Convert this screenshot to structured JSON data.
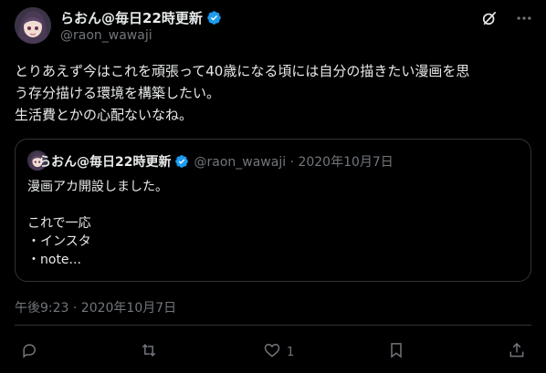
{
  "author": {
    "display_name": "らおん@毎日22時更新",
    "handle": "@raon_wawaji"
  },
  "tweet": {
    "text": "とりあえず今はこれを頑張って40歳になる頃には自分の描きたい漫画を思\nう存分描ける環境を構築したい。\n生活費とかの心配ないなね。",
    "timestamp": "午後9:23 · 2020年10月7日"
  },
  "quoted_tweet": {
    "display_name": "らおん@毎日22時更新",
    "meta": "@raon_wawaji · 2020年10月7日",
    "text": "漫画アカ開設しました。\n\nこれで一応\n・インスタ\n・note..."
  },
  "actions": {
    "like_count": "1"
  },
  "colors": {
    "background": "#000000",
    "text": "#e7e9ea",
    "muted": "#71767b",
    "border": "#2f3336",
    "verified": "#1d9bf0"
  },
  "icons": [
    "grok-icon",
    "more-icon",
    "reply-icon",
    "retweet-icon",
    "like-icon",
    "bookmark-icon",
    "share-icon",
    "verified-icon"
  ]
}
